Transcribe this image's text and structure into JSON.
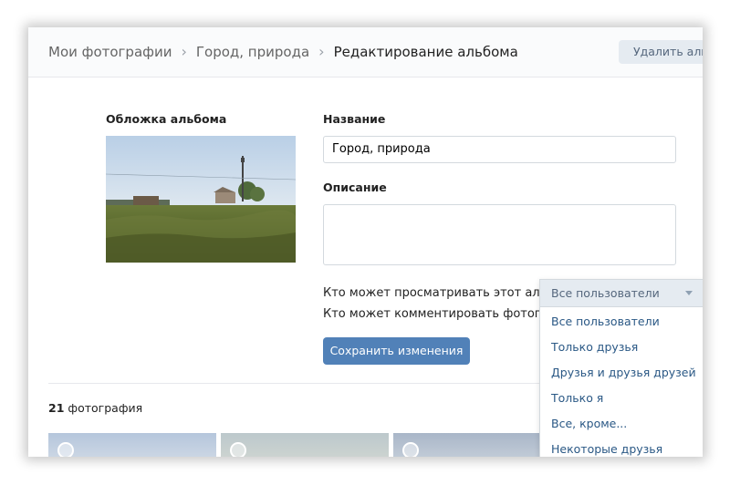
{
  "breadcrumb": {
    "items": [
      "Мои фотографии",
      "Город, природа"
    ],
    "current": "Редактирование альбома"
  },
  "header": {
    "delete_label": "Удалить альбом"
  },
  "cover": {
    "label": "Обложка альбома"
  },
  "form": {
    "name_label": "Название",
    "name_value": "Город, природа",
    "description_label": "Описание",
    "description_value": "",
    "view_privacy_label": "Кто может просматривать этот альбом?",
    "comment_privacy_label": "Кто может комментировать фотографии?",
    "save_label": "Сохранить изменения"
  },
  "photos": {
    "count": "21",
    "count_label": "фотография"
  },
  "privacy_dropdown": {
    "selected": "Все пользователи",
    "options": [
      "Все пользователи",
      "Только друзья",
      "Друзья и друзья друзей",
      "Только я",
      "Все, кроме...",
      "Некоторые друзья"
    ]
  },
  "colors": {
    "accent": "#5181b8",
    "link": "#2a5885",
    "secondary_button_bg": "#e5ebf1"
  }
}
